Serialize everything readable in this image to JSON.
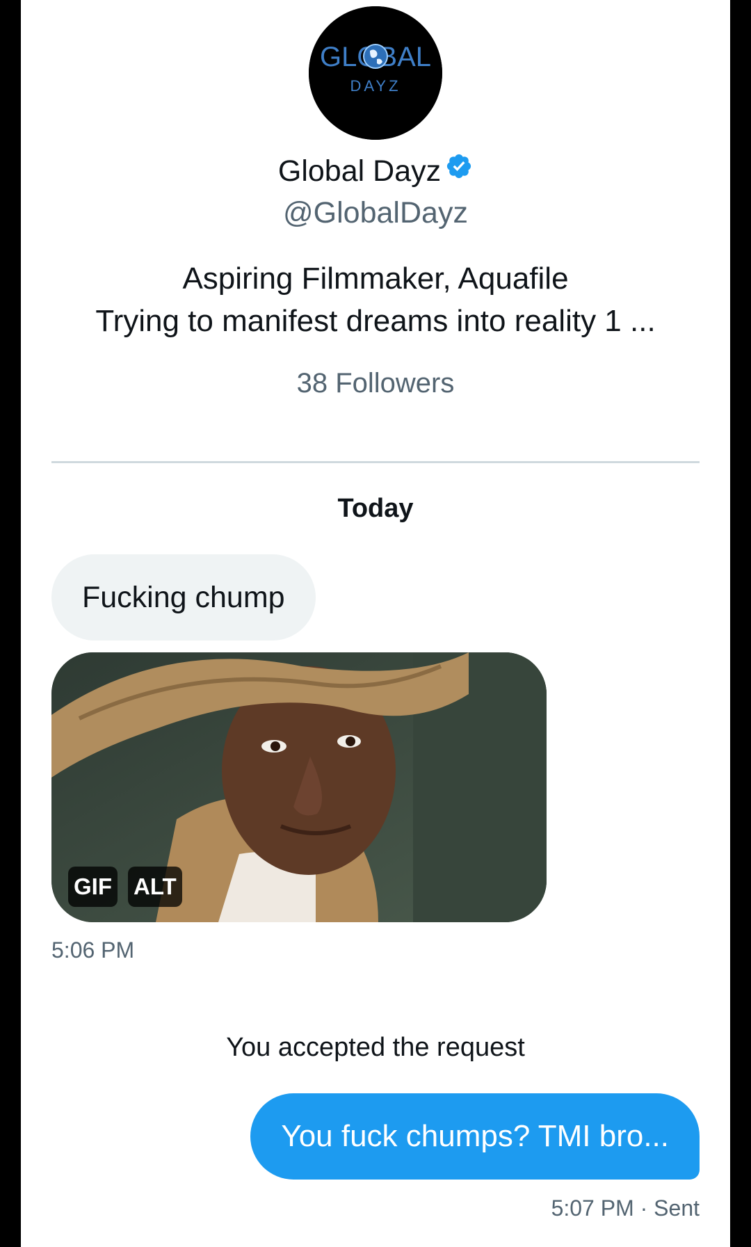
{
  "profile": {
    "logo_text": "GLOBAL",
    "logo_subtext": "DAYZ",
    "name": "Global Dayz",
    "handle": "@GlobalDayz",
    "bio_line1": "Aspiring Filmmaker, Aquafile",
    "bio_line2": "Trying to manifest dreams into reality 1 ...",
    "followers": "38 Followers"
  },
  "conversation": {
    "day_label": "Today",
    "incoming": {
      "text": "Fucking chump",
      "gif_badge": "GIF",
      "alt_badge": "ALT",
      "time": "5:06 PM"
    },
    "system_notice": "You accepted the request",
    "outgoing": {
      "text": "You fuck chumps? TMI bro...",
      "status": "5:07 PM · Sent"
    }
  },
  "colors": {
    "accent": "#1d9bf0",
    "text_primary": "#0f1419",
    "text_secondary": "#536471",
    "bubble_incoming": "#eff3f4",
    "divider": "#cfd9de"
  },
  "icons": [
    "verified-badge-icon",
    "globe-icon"
  ]
}
